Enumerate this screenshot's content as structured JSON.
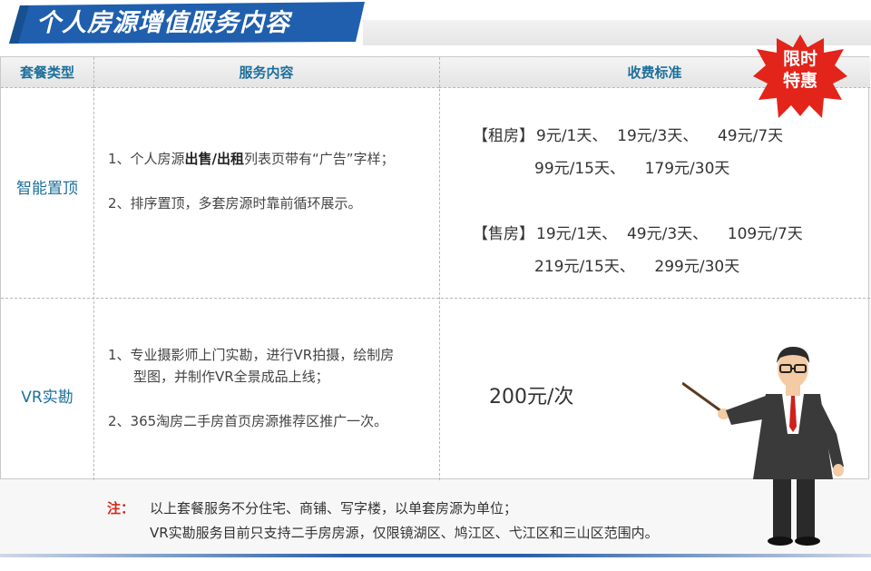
{
  "header": {
    "title": "个人房源增值服务内容"
  },
  "table": {
    "columns": [
      "套餐类型",
      "服务内容",
      "收费标准"
    ],
    "rows": [
      {
        "type": "智能置顶",
        "service": {
          "item1_prefix": "1、个人房源",
          "item1_bold": "出售/出租",
          "item1_suffix": "列表页带有“广告”字样；",
          "item2": "2、排序置顶，多套房源时靠前循环展示。"
        },
        "pricing": {
          "rent_label": "【租房】",
          "rent_line1": "9元/1天、  19元/3天、    49元/7天",
          "rent_line2": "99元/15天、    179元/30天",
          "sale_label": "【售房】",
          "sale_line1": "19元/1天、  49元/3天、    109元/7天",
          "sale_line2": "219元/15天、    299元/30天"
        }
      },
      {
        "type": "VR实勘",
        "service": {
          "item1_line1": "1、专业摄影师上门实勘，进行VR拍摄，绘制房",
          "item1_line2": "型图，并制作VR全景成品上线；",
          "item2": "2、365淘房二手房首页房源推荐区推广一次。"
        },
        "pricing": {
          "price": "200元/次"
        }
      }
    ]
  },
  "badge": {
    "line1": "限时",
    "line2": "特惠"
  },
  "notes": {
    "label": "注：",
    "line1": "以上套餐服务不分住宅、商铺、写字楼，以单套房源为单位；",
    "line2": "VR实勘服务目前只支持二手房房源，仅限镜湖区、鸠江区、弋江区和三山区范围内。"
  },
  "colors": {
    "banner_blue": "#1f5fae",
    "header_text": "#1d6f9b",
    "badge_red": "#e3241b",
    "note_red": "#d42a1c"
  },
  "icons": [
    "starburst-badge",
    "presenter-man-illustration"
  ]
}
